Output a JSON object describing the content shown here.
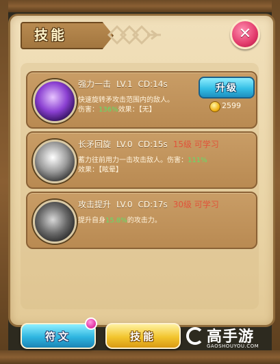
{
  "window": {
    "title": "技能",
    "close_label": "✕"
  },
  "skills": [
    {
      "name": "强力一击",
      "level": "LV.1",
      "cooldown": "CD:14s",
      "requirement": "",
      "desc_line1": "快速旋转矛攻击范围内的敌人。",
      "desc_prefix": "伤害：",
      "desc_value": "136%",
      "desc_suffix": "效果：【无】",
      "upgrade_label": "升级",
      "cost": "2599",
      "icon": "purple-spear-spin-icon"
    },
    {
      "name": "长矛回旋",
      "level": "LV.0",
      "cooldown": "CD:15s",
      "requirement": "15级 可学习",
      "desc_prefix": "蓄力往前用力一击攻击敌人。伤害：",
      "desc_value": "111%",
      "desc_suffix": "效果：【眩晕】",
      "icon": "spear-whirl-icon"
    },
    {
      "name": "攻击提升",
      "level": "LV.0",
      "cooldown": "CD:17s",
      "requirement": "30级 可学习",
      "desc_prefix": "提升自身",
      "desc_value": "15.8%",
      "desc_suffix": "的攻击力。",
      "icon": "attack-boost-icon"
    }
  ],
  "tabs": [
    {
      "label": "符文"
    },
    {
      "label": "技能"
    }
  ],
  "watermark": {
    "name": "高手游",
    "url": "GAOSHOUYOU.COM"
  },
  "colors": {
    "accent_blue": "#35bfe6",
    "accent_gold": "#f2c52e",
    "highlight_green": "#5fe06a",
    "requirement_red": "#e0533a",
    "close_pink": "#e23a6b"
  }
}
